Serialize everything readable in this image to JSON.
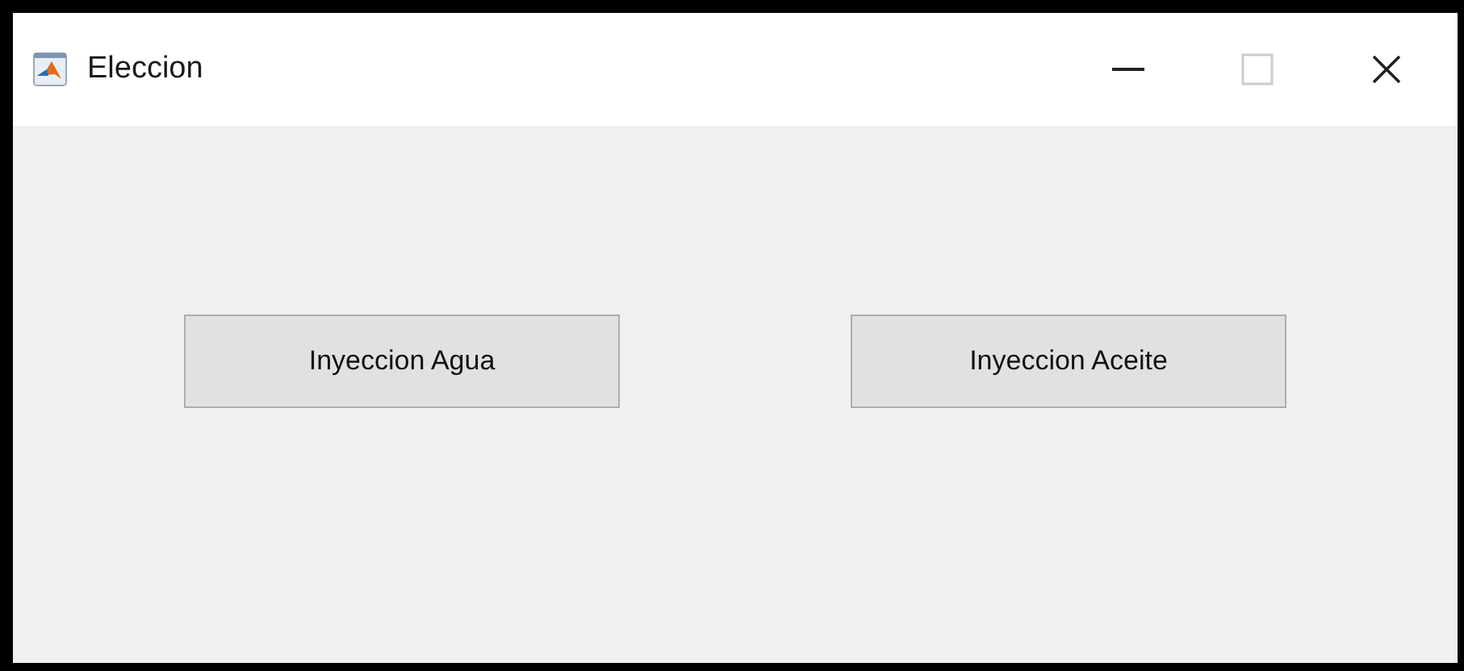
{
  "window": {
    "title": "Eleccion"
  },
  "buttons": [
    {
      "label": "Inyeccion Agua"
    },
    {
      "label": "Inyeccion Aceite"
    }
  ]
}
